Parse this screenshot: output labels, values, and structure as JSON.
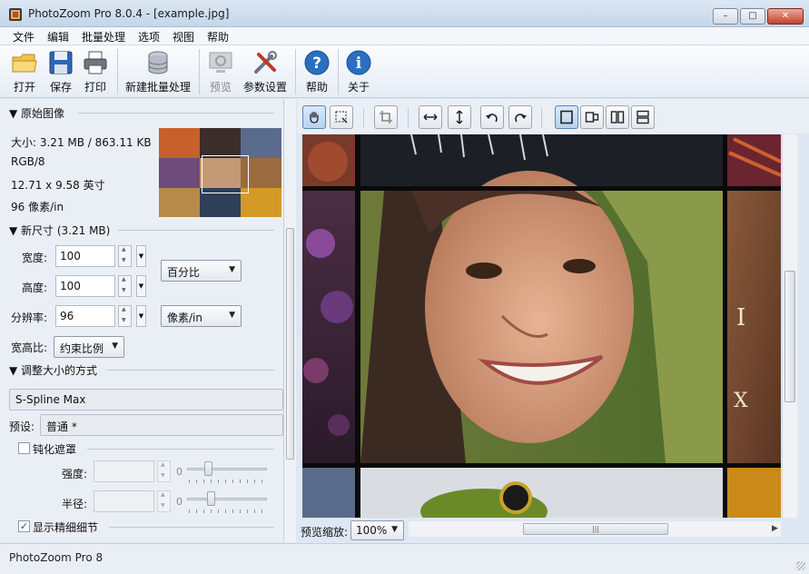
{
  "window": {
    "title": "PhotoZoom Pro 8.0.4 - [example.jpg]",
    "min": "–",
    "max": "□",
    "close": "✕"
  },
  "menu": [
    "文件",
    "编辑",
    "批量处理",
    "选项",
    "视图",
    "帮助"
  ],
  "toolbar": {
    "open": "打开",
    "save": "保存",
    "print": "打印",
    "batch": "新建批量处理",
    "preview": "预览",
    "settings": "参数设置",
    "help": "帮助",
    "about": "关于"
  },
  "original": {
    "header": "▼ 原始图像",
    "size": "大小: 3.21 MB / 863.11 KB",
    "mode": "RGB/8",
    "dimensions": "12.71 x 9.58 英寸",
    "resolution": "96 像素/in"
  },
  "new_size": {
    "header": "▼ 新尺寸 (3.21 MB)",
    "width_label": "宽度:",
    "width_value": "100",
    "height_label": "高度:",
    "height_value": "100",
    "res_label": "分辨率:",
    "res_value": "96",
    "unit_select": "百分比",
    "res_unit_select": "像素/in",
    "aspect_label": "宽高比:",
    "aspect_select": "约束比例"
  },
  "resize_method": {
    "header": "▼ 调整大小的方式",
    "method": "S-Spline Max",
    "preset_label": "预设:",
    "preset_value": "普通 *"
  },
  "unsharp": {
    "label": "钝化遮罩",
    "checked": false,
    "strength_label": "强度:",
    "strength_value": "0",
    "radius_label": "半径:",
    "radius_value": "0"
  },
  "fine_detail": {
    "label": "显示精细细节",
    "checked": true
  },
  "preview_zoom": {
    "label": "预览缩放:",
    "value": "100%"
  },
  "status": {
    "text": "PhotoZoom Pro 8"
  },
  "colors": {
    "accent": "#2a6fc0",
    "panel": "#eaeff5"
  }
}
